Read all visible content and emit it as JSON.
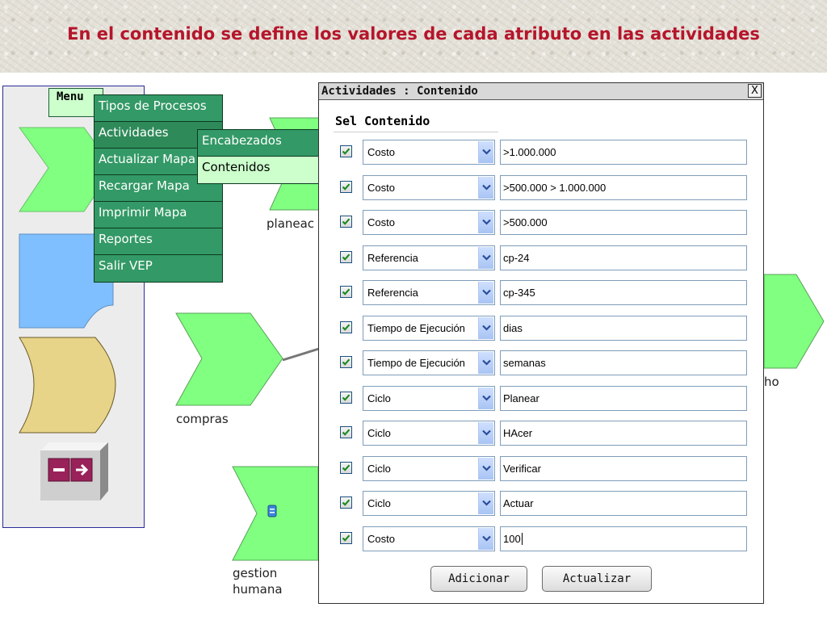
{
  "slide": {
    "title": "En el contenido se define los valores de cada atributo en las actividades"
  },
  "colors": {
    "title": "#b5152b",
    "menu_green": "#339966",
    "menu_highlight": "#ccffcc",
    "shape_green": "#80ff80",
    "shape_blue": "#80bfff",
    "shape_tan": "#e8d488",
    "button_purple": "#99225a"
  },
  "toolbox": {
    "menu_label": "Menu",
    "tools": [
      "activity-shape-tool",
      "document-shape-tool",
      "decision-shape-tool",
      "arrow-connector-tool"
    ]
  },
  "map": {
    "labels": {
      "planeacion": "planeac",
      "compras": "compras",
      "gestion_line1": "gestion",
      "gestion_line2": "humana",
      "right_partial": "ho"
    }
  },
  "main_menu": {
    "items": [
      {
        "label": "Tipos de Procesos"
      },
      {
        "label": "Actividades"
      },
      {
        "label": "Actualizar Mapa"
      },
      {
        "label": "Recargar Mapa"
      },
      {
        "label": "Imprimir Mapa"
      },
      {
        "label": "Reportes"
      },
      {
        "label": "Salir VEP"
      }
    ]
  },
  "submenu": {
    "items": [
      {
        "label": "Encabezados"
      },
      {
        "label": "Contenidos"
      }
    ]
  },
  "dialog": {
    "title": "Actividades : Contenido",
    "close_label": "X",
    "col_sel": "Sel",
    "col_contenido": "Contenido",
    "rows": [
      {
        "checked": true,
        "attribute": "Costo",
        "value": ">1.000.000"
      },
      {
        "checked": true,
        "attribute": "Costo",
        "value": ">500.000 > 1.000.000"
      },
      {
        "checked": true,
        "attribute": "Costo",
        "value": ">500.000"
      },
      {
        "checked": true,
        "attribute": "Referencia",
        "value": "cp-24"
      },
      {
        "checked": true,
        "attribute": "Referencia",
        "value": "cp-345"
      },
      {
        "checked": true,
        "attribute": "Tiempo de Ejecución",
        "value": "dias"
      },
      {
        "checked": true,
        "attribute": "Tiempo de Ejecución",
        "value": "semanas"
      },
      {
        "checked": true,
        "attribute": "Ciclo",
        "value": "Planear"
      },
      {
        "checked": true,
        "attribute": "Ciclo",
        "value": "HAcer"
      },
      {
        "checked": true,
        "attribute": "Ciclo",
        "value": "Verificar"
      },
      {
        "checked": true,
        "attribute": "Ciclo",
        "value": "Actuar"
      },
      {
        "checked": true,
        "attribute": "Costo",
        "value": "100"
      }
    ],
    "buttons": {
      "add": "Adicionar",
      "update": "Actualizar"
    }
  }
}
